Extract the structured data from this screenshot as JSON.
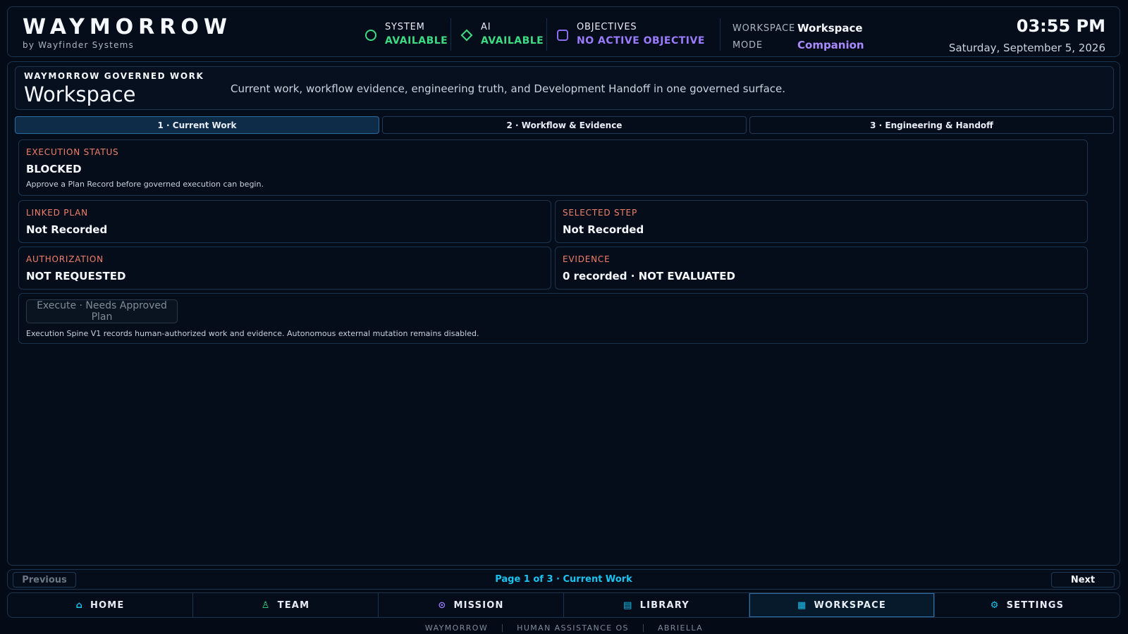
{
  "header": {
    "brand": "WAYMORROW",
    "brand_sub": "by Wayfinder Systems",
    "statuses": [
      {
        "label": "SYSTEM",
        "value": "AVAILABLE",
        "icon": "circle-icon",
        "color": "#3ddc84"
      },
      {
        "label": "AI",
        "value": "AVAILABLE",
        "icon": "diamond-icon",
        "color": "#3ddc84"
      },
      {
        "label": "OBJECTIVES",
        "value": "NO ACTIVE OBJECTIVE",
        "icon": "rounded-square-icon",
        "color": "#9b7bff"
      }
    ],
    "workspace_key": "WORKSPACE",
    "workspace_value": "Workspace",
    "mode_key": "MODE",
    "mode_value": "Companion",
    "time": "03:55 PM",
    "date": "Saturday, September 5, 2026"
  },
  "main": {
    "eyebrow": "WAYMORROW GOVERNED WORK",
    "title": "Workspace",
    "description": "Current work, workflow evidence, engineering truth, and Development Handoff in one governed surface.",
    "tabs": [
      {
        "label": "1 · Current Work",
        "active": true
      },
      {
        "label": "2 · Workflow & Evidence",
        "active": false
      },
      {
        "label": "3 · Engineering & Handoff",
        "active": false
      }
    ],
    "execution_status": {
      "label": "EXECUTION STATUS",
      "value": "BLOCKED",
      "note": "Approve a Plan Record before governed execution can begin."
    },
    "linked_plan": {
      "label": "LINKED PLAN",
      "value": "Not Recorded"
    },
    "selected_step": {
      "label": "SELECTED STEP",
      "value": "Not Recorded"
    },
    "authorization": {
      "label": "AUTHORIZATION",
      "value": "NOT REQUESTED"
    },
    "evidence": {
      "label": "EVIDENCE",
      "value": "0 recorded · NOT EVALUATED"
    },
    "execute": {
      "button_label": "Execute · Needs Approved Plan",
      "note": "Execution Spine V1 records human-authorized work and evidence. Autonomous external mutation remains disabled."
    }
  },
  "pager": {
    "previous": "Previous",
    "info": "Page 1 of 3 · Current Work",
    "next": "Next"
  },
  "nav": {
    "items": [
      {
        "label": "HOME",
        "icon": "home-icon",
        "active": false
      },
      {
        "label": "TEAM",
        "icon": "person-icon",
        "active": false
      },
      {
        "label": "MISSION",
        "icon": "target-icon",
        "active": false
      },
      {
        "label": "LIBRARY",
        "icon": "book-icon",
        "active": false
      },
      {
        "label": "WORKSPACE",
        "icon": "grid-icon",
        "active": true
      },
      {
        "label": "SETTINGS",
        "icon": "gear-icon",
        "active": false
      }
    ]
  },
  "footer": {
    "items": [
      "WAYMORROW",
      "HUMAN ASSISTANCE OS",
      "ABRIELLA"
    ]
  },
  "colors": {
    "accent": "#19c3f0",
    "ok": "#3ddc84",
    "purple": "#9b7bff",
    "label": "#f0806a",
    "background": "#040b16"
  }
}
